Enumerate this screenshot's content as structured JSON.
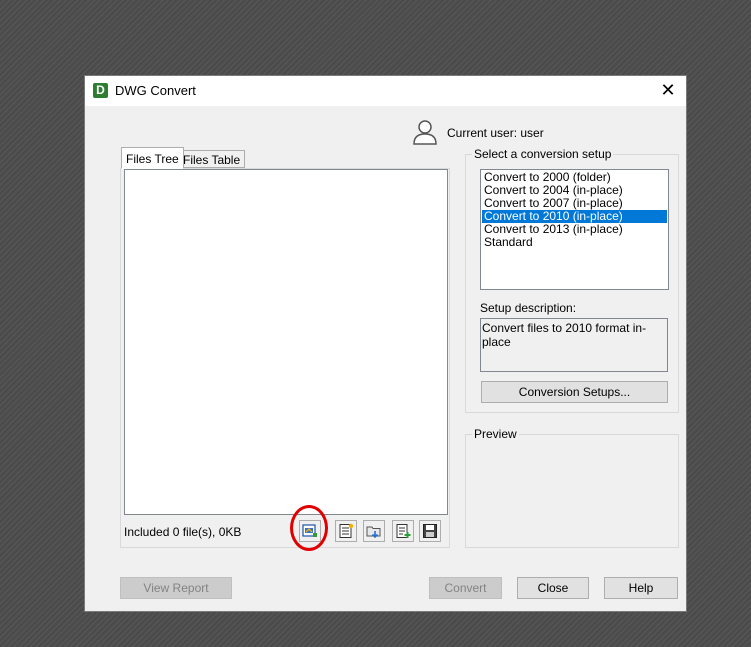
{
  "window": {
    "title": "DWG Convert",
    "app_icon_letter": "D"
  },
  "user": {
    "label": "Current user: user"
  },
  "tabs": [
    {
      "label": "Files Tree"
    },
    {
      "label": "Files Table"
    }
  ],
  "files": {
    "summary": "Included 0 file(s), 0KB"
  },
  "toolbar": {
    "icons": [
      "add-files-icon",
      "new-list-icon",
      "open-folder-icon",
      "add-list-icon",
      "save-icon"
    ]
  },
  "setups": {
    "group_title": "Select a conversion setup",
    "items": [
      {
        "label": "Convert to 2000 (folder)",
        "selected": false
      },
      {
        "label": "Convert to 2004 (in-place)",
        "selected": false
      },
      {
        "label": "Convert to 2007 (in-place)",
        "selected": false
      },
      {
        "label": "Convert to 2010 (in-place)",
        "selected": true
      },
      {
        "label": "Convert to 2013 (in-place)",
        "selected": false
      },
      {
        "label": "Standard",
        "selected": false
      }
    ],
    "description_label": "Setup description:",
    "description": "Convert files to 2010 format in-place",
    "button_label": "Conversion Setups..."
  },
  "preview": {
    "group_title": "Preview"
  },
  "buttons": {
    "view_report": "View Report",
    "convert": "Convert",
    "close": "Close",
    "help": "Help"
  },
  "colors": {
    "selection": "#0078d7",
    "highlight_circle": "#e00000",
    "app_icon": "#2e7d32"
  }
}
